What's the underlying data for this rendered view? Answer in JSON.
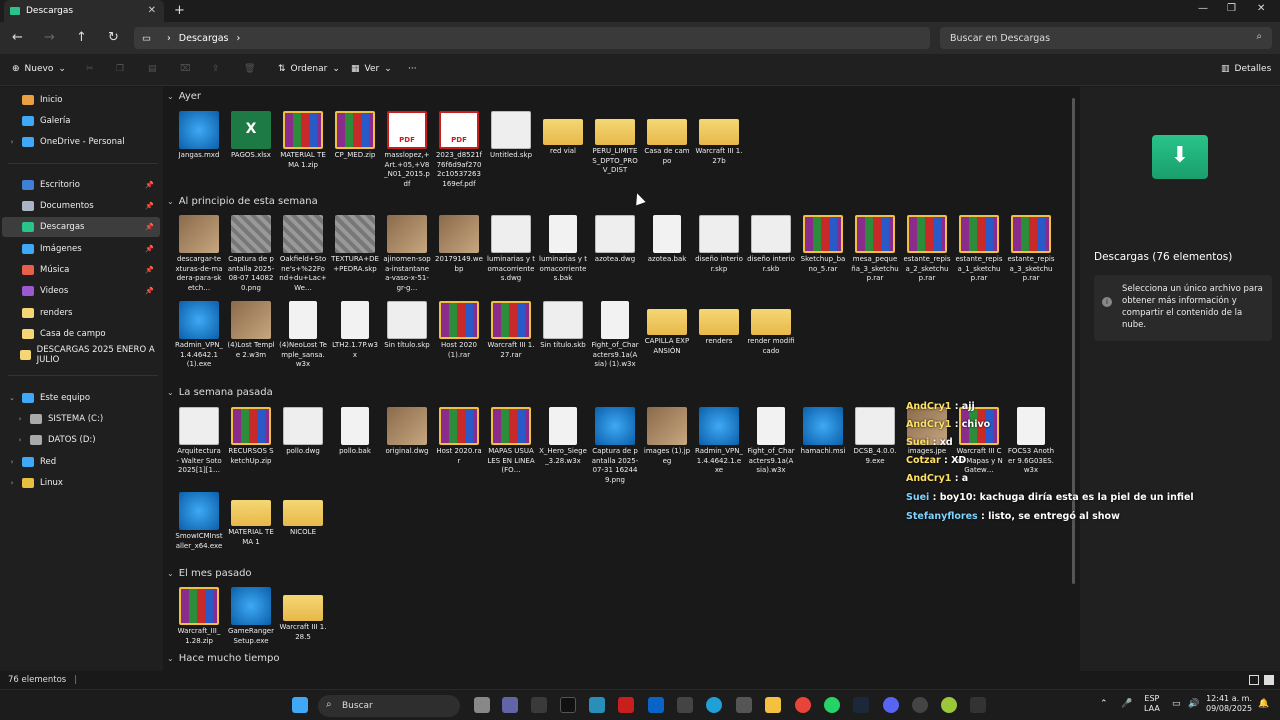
{
  "window": {
    "tab_title": "Descargas",
    "tab_close": "✕",
    "new_tab": "+",
    "minimize": "—",
    "maximize": "❐",
    "close": "✕"
  },
  "address": {
    "path": "Descargas",
    "search_placeholder": "Buscar en Descargas"
  },
  "commands": {
    "new": "Nuevo",
    "sort": "Ordenar",
    "view": "Ver",
    "more": "···",
    "details": "Detalles"
  },
  "nav": {
    "items": [
      {
        "label": "Inicio",
        "color": "#e8a040"
      },
      {
        "label": "Galería",
        "color": "#3fa9f5"
      },
      {
        "label": "OneDrive - Personal",
        "color": "#3fa9f5"
      },
      {
        "label": "Escritorio",
        "color": "#3f7fd5"
      },
      {
        "label": "Documentos",
        "color": "#aab4c4"
      },
      {
        "label": "Descargas",
        "color": "#28c48a"
      },
      {
        "label": "Imágenes",
        "color": "#3fa9f5"
      },
      {
        "label": "Música",
        "color": "#e8604a"
      },
      {
        "label": "Videos",
        "color": "#9b59d0"
      },
      {
        "label": "renders",
        "color": "#f4d774"
      },
      {
        "label": "Casa de campo",
        "color": "#f4d774"
      },
      {
        "label": "DESCARGAS 2025 ENERO A JULIO",
        "color": "#f4d774"
      },
      {
        "label": "Este equipo",
        "color": "#3fa9f5"
      },
      {
        "label": "SISTEMA (C:)",
        "color": "#aaa"
      },
      {
        "label": "DATOS (D:)",
        "color": "#aaa"
      },
      {
        "label": "Red",
        "color": "#3fa9f5"
      },
      {
        "label": "Linux",
        "color": "#e8c040"
      }
    ]
  },
  "groups": {
    "ayer": "Ayer",
    "semana": "Al principio de esta semana",
    "pasada": "La semana pasada",
    "mes": "El mes pasado",
    "mucho": "Hace mucho tiempo"
  },
  "files": {
    "ayer": [
      "Jangas.mxd",
      "PAGOS.xlsx",
      "MATERIAL TEMA 1.zip",
      "CP_MED.zip",
      "masslopez,+Art.+05,+V8_N01_2015.pdf",
      "2023_d8521f76f6d9af2702c10537263169ef.pdf",
      "Untitled.skp",
      "red vial",
      "PERU_LIMITES_DPTO_PROV_DIST",
      "Casa de campo",
      "Warcraft III 1.27b"
    ],
    "semana1": [
      "descargar-texturas-de-madera-para-sketch…",
      "Captura de pantalla 2025-08-07 140820.png",
      "Oakfield+Stone's+%22Fond+du+Lac+We…",
      "TEXTURA+DE+PEDRA.skp",
      "ajinomen-sopa-instantanea-vaso-x-51-gr-g…",
      "20179149.webp",
      "luminarias y tomacorrientes.dwg",
      "luminarias y tomacorrientes.bak",
      "azotea.dwg",
      "azotea.bak",
      "diseño interior.skp",
      "diseño interior.skb",
      "Sketchup_bano_5.rar",
      "mesa_pequeña_3_sketchup.rar",
      "estante_repisa_2_sketchup.rar",
      "estante_repisa_1_sketchup.rar",
      "estante_repisa_3_sketchup.rar"
    ],
    "semana2": [
      "Radmin_VPN_1.4.4642.1 (1).exe",
      "(4)Lost Temple 2.w3m",
      "(4)NeoLost Temple_sansa.w3x",
      "LTH2.1.7P.w3x",
      "Sin título.skp",
      "Host 2020 (1).rar",
      "Warcraft III 1.27.rar",
      "Sin título.skb",
      "Fight_of_Characters9.1a(Asia) (1).w3x",
      "CAPILLA EXPANSIÓN",
      "renders",
      "render modificado"
    ],
    "pasada1": [
      "Arquitectura - Walter Soto 2025[1][1…",
      "RECURSOS SketchUp.zip",
      "pollo.dwg",
      "pollo.bak",
      "original.dwg",
      "Host 2020.rar",
      "MAPAS USUALES EN LINEA(FO…",
      "X_Hero_Siege_3.28.w3x",
      "Captura de pantalla 2025-07-31 162449.png",
      "images (1).jpeg",
      "Radmin_VPN_1.4.4642.1.exe",
      "Fight_of_Characters9.1a(Asia).w3x",
      "hamachi.msi",
      "DCSB_4.0.0.9.exe",
      "images.jpe",
      "Warcraft III Con Mapas y NGatew…",
      "FOCS3 Another 9.6G03ES.w3x"
    ],
    "pasada2": [
      "SmowICMInstaller_x64.exe",
      "MATERIAL TEMA 1",
      "NICOLE"
    ],
    "mes": [
      "Warcraft_III_1.28.zip",
      "GameRangerSetup.exe",
      "Warcraft III 1.28.5"
    ]
  },
  "details": {
    "title": "Descargas (76 elementos)",
    "info": "Selecciona un único archivo para obtener más información y compartir el contenido de la nube."
  },
  "status": {
    "count": "76 elementos"
  },
  "chat": [
    {
      "user": "AndCry1",
      "text": " : ajj"
    },
    {
      "user": "AndCry1",
      "text": " : chivo"
    },
    {
      "user": "Suei",
      "text": " : xd"
    },
    {
      "user": "Cotzar",
      "text": " : XD"
    },
    {
      "user": "AndCry1",
      "text": " : a"
    },
    {
      "user": "Suei",
      "text": " : boy10: kachuga diría esta es la piel de un infiel"
    },
    {
      "user": "Stefanyflores",
      "text": " : listo, se entregó al show"
    }
  ],
  "taskbar": {
    "search": "Buscar",
    "lang1": "ESP",
    "lang2": "LAA",
    "time": "12:41 a. m.",
    "date": "09/08/2025"
  }
}
